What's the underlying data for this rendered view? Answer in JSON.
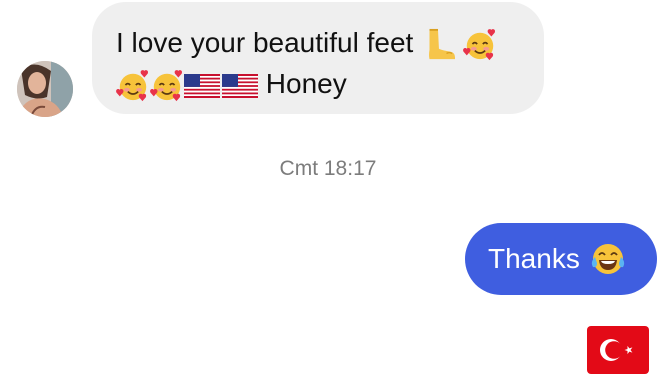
{
  "conversation": {
    "incoming": {
      "line1": "I love your beautiful feet",
      "line2_text": "Honey",
      "emojis_line1": [
        "foot-emoji",
        "smiling-face-with-hearts-emoji"
      ],
      "emojis_line2": [
        "smiling-face-with-hearts-emoji",
        "smiling-face-with-hearts-emoji",
        "us-flag-emoji",
        "us-flag-emoji"
      ]
    },
    "timestamp": "Cmt 18:17",
    "outgoing": {
      "text": "Thanks",
      "emoji": "face-with-tears-of-joy-emoji"
    },
    "reaction_flag": "turkey-flag-emoji"
  },
  "colors": {
    "incoming_bubble": "#efefef",
    "outgoing_bubble": "#3f5ee0",
    "timestamp_text": "#7c7c7c"
  }
}
